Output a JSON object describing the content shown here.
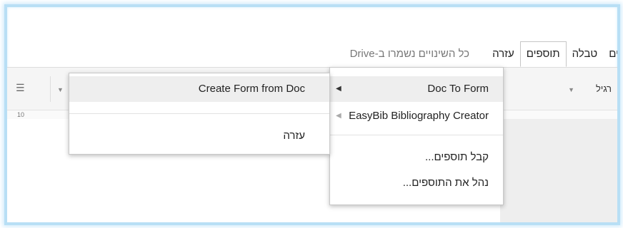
{
  "menubar": {
    "items": [
      "ים",
      "טבלה",
      "תוספים",
      "עזרה"
    ],
    "save_status": "כל השינויים נשמרו ב-Drive"
  },
  "toolbar": {
    "style_value": "רגיל"
  },
  "ruler": {
    "mark": "10"
  },
  "addons_menu": {
    "items": [
      {
        "label": "Doc To Form",
        "has_submenu": true
      },
      {
        "label": "EasyBib Bibliography Creator",
        "has_submenu": true
      },
      {
        "label": "קבל תוספים..."
      },
      {
        "label": "נהל את התוספים..."
      }
    ]
  },
  "submenu": {
    "items": [
      {
        "label": "Create Form from Doc"
      },
      {
        "label": "עזרה"
      }
    ]
  },
  "icons": {
    "submenu_arrow": "triangle-left",
    "list_icon": "numbered-list-icon",
    "dropdown": "chevron-down-icon"
  },
  "colors": {
    "frame_glow": "#b8dff5",
    "menu_highlight": "#eeeeee",
    "toolbar_bg": "#f5f5f5"
  }
}
